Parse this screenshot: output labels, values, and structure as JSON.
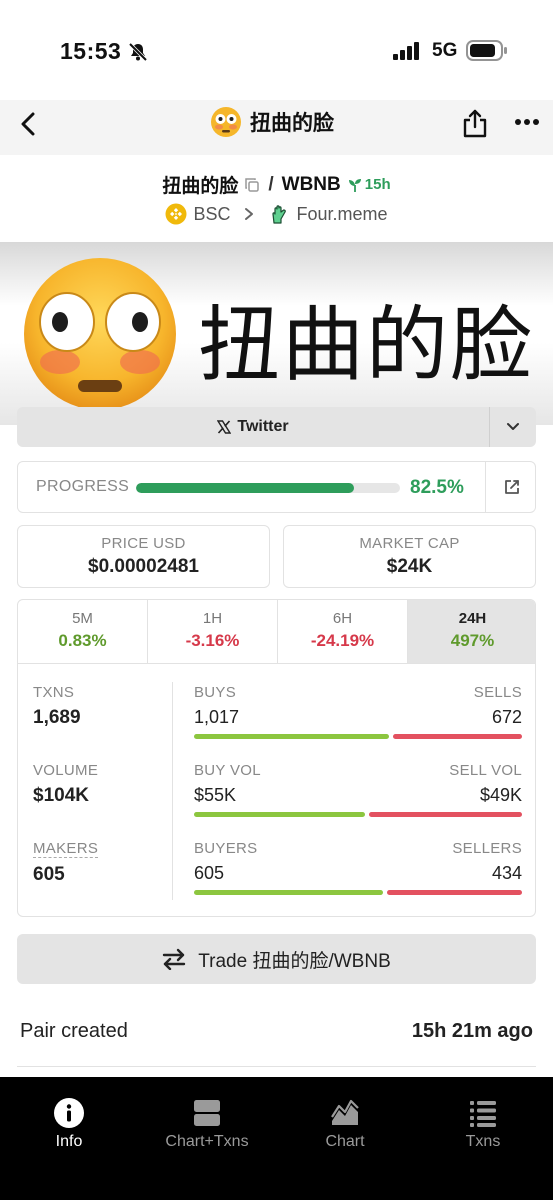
{
  "status_bar": {
    "time": "15:53",
    "network": "5G"
  },
  "nav": {
    "title": "扭曲的脸"
  },
  "pair": {
    "base": "扭曲的脸",
    "separator": "/",
    "quote": "WBNB",
    "age": "15h",
    "chain": "BSC",
    "dex": "Four.meme"
  },
  "banner": {
    "text": "扭曲的脸"
  },
  "socials": {
    "twitter_label": "Twitter"
  },
  "progress": {
    "label": "PROGRESS",
    "value_text": "82.5%",
    "fraction": 0.825
  },
  "stats": {
    "price_label": "PRICE USD",
    "price_value": "$0.00002481",
    "mcap_label": "MARKET CAP",
    "mcap_value": "$24K"
  },
  "periods": [
    {
      "label": "5M",
      "change": "0.83%",
      "direction": "up",
      "active": false
    },
    {
      "label": "1H",
      "change": "-3.16%",
      "direction": "down",
      "active": false
    },
    {
      "label": "6H",
      "change": "-24.19%",
      "direction": "down",
      "active": false
    },
    {
      "label": "24H",
      "change": "497%",
      "direction": "up",
      "active": true
    }
  ],
  "metrics": {
    "txns_label": "TXNS",
    "txns_value": "1,689",
    "volume_label": "VOLUME",
    "volume_value": "$104K",
    "makers_label": "MAKERS",
    "makers_value": "605",
    "buys_label": "BUYS",
    "buys_value": "1,017",
    "buys_count": 1017,
    "sells_label": "SELLS",
    "sells_value": "672",
    "sells_count": 672,
    "buyvol_label": "BUY VOL",
    "buyvol_value": "$55K",
    "buyvol_amount": 55,
    "sellvol_label": "SELL VOL",
    "sellvol_value": "$49K",
    "sellvol_amount": 49,
    "buyers_label": "BUYERS",
    "buyers_value": "605",
    "buyers_count": 605,
    "sellers_label": "SELLERS",
    "sellers_value": "434",
    "sellers_count": 434
  },
  "trade_button": {
    "label": "Trade 扭曲的脸/WBNB"
  },
  "pair_created": {
    "label": "Pair created",
    "value": "15h 21m ago"
  },
  "tab_bar": {
    "items": [
      {
        "label": "Info",
        "icon": "info-icon",
        "active": true
      },
      {
        "label": "Chart+Txns",
        "icon": "split-view-icon",
        "active": false
      },
      {
        "label": "Chart",
        "icon": "area-chart-icon",
        "active": false
      },
      {
        "label": "Txns",
        "icon": "list-icon",
        "active": false
      }
    ]
  },
  "colors": {
    "green": "#2e9d5b",
    "buy_bar": "#8cc63f",
    "sell_bar": "#e35160",
    "negative": "#d6394a",
    "positive": "#5f9a2c"
  }
}
